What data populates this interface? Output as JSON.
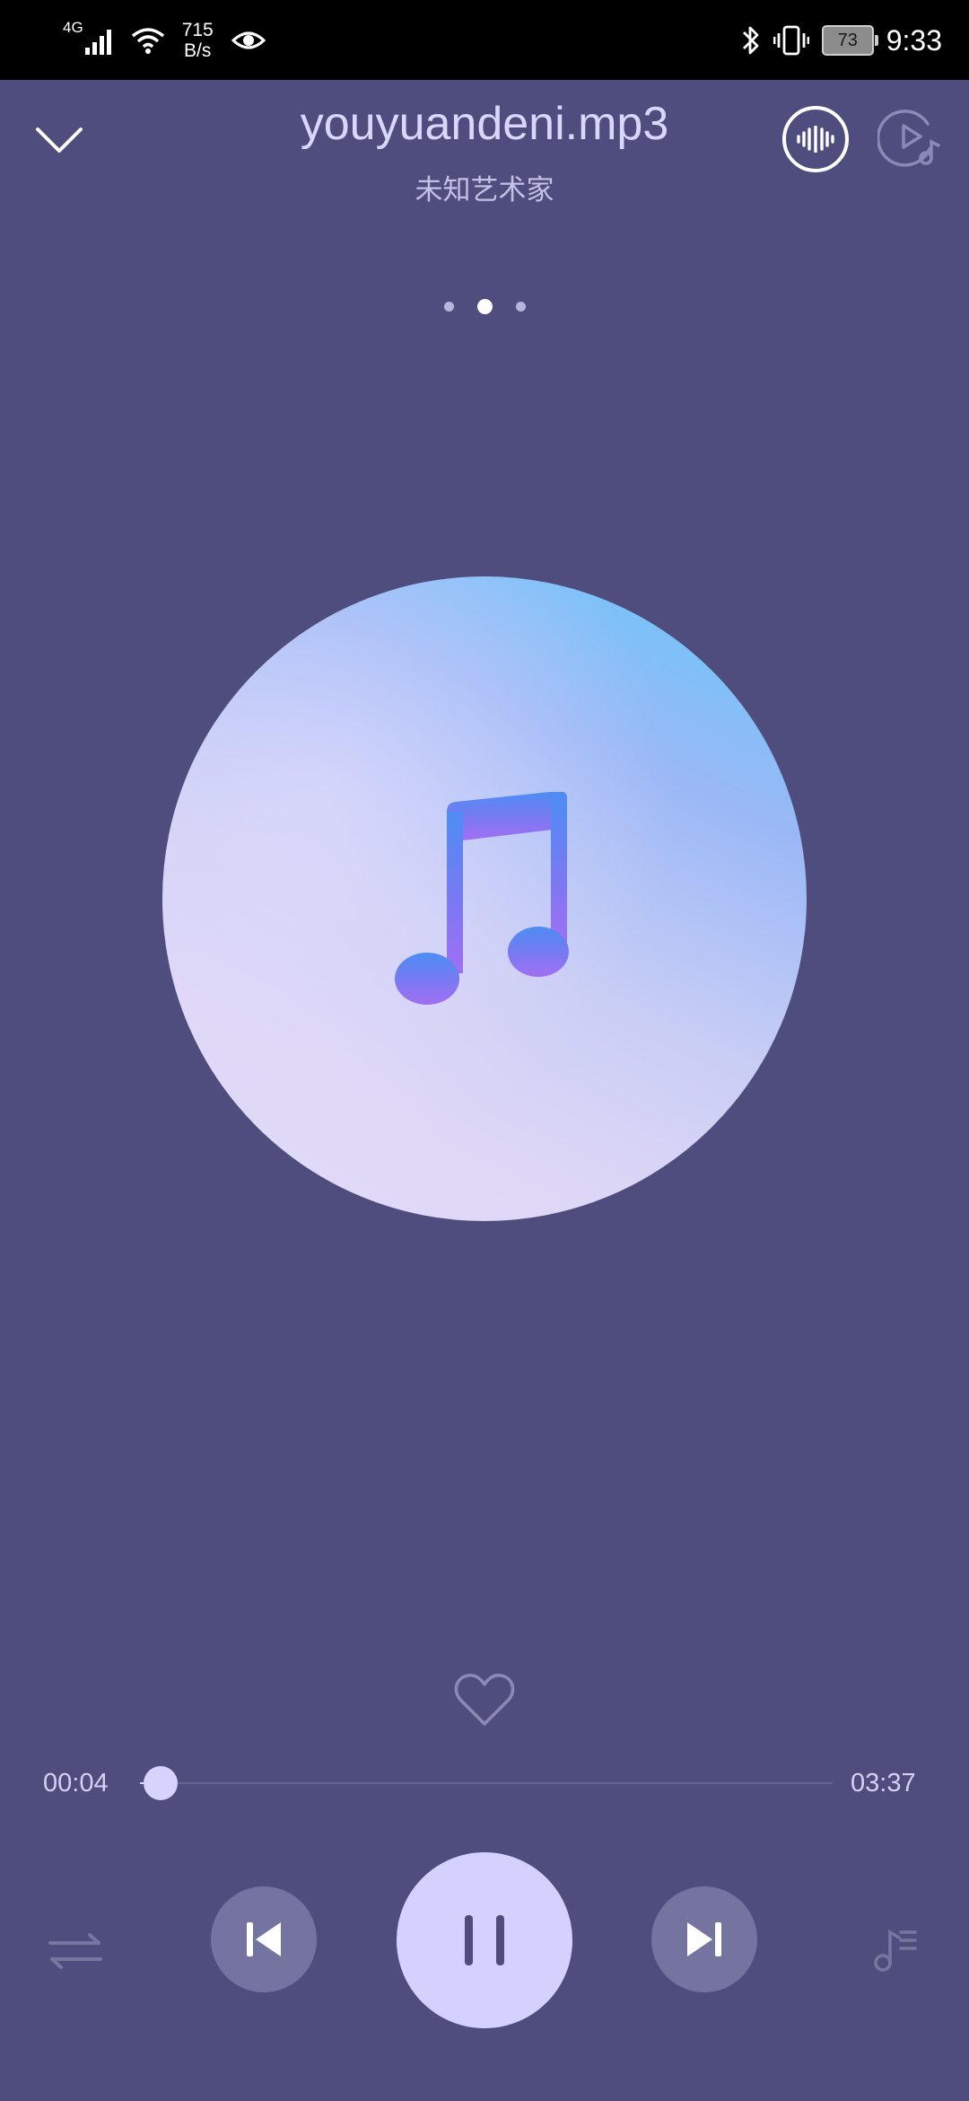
{
  "status_bar": {
    "network_type": "4G",
    "speed_value": "715",
    "speed_unit": "B/s",
    "battery": "73",
    "time": "9:33",
    "icons": [
      "signal-icon",
      "wifi-icon",
      "eye-icon",
      "bluetooth-icon",
      "vibrate-icon",
      "battery-icon"
    ]
  },
  "player": {
    "title": "youyuandeni.mp3",
    "artist": "未知艺术家",
    "page_dots": 3,
    "active_page": 2,
    "elapsed": "00:04",
    "duration": "03:37",
    "progress_fraction": 0.03,
    "liked": false,
    "is_playing": true
  },
  "icons": {
    "collapse": "chevron-down-icon",
    "sound_effect": "sound-wave-icon",
    "playlist_add": "play-music-icon",
    "album_art": "music-note-icon",
    "like": "heart-icon",
    "repeat": "repeat-icon",
    "previous": "skip-previous-icon",
    "pause": "pause-icon",
    "next": "skip-next-icon",
    "queue": "queue-music-icon"
  },
  "colors": {
    "background": "#4e4d7d",
    "accent": "#d4d0ff",
    "title": "#d9d6ff"
  }
}
